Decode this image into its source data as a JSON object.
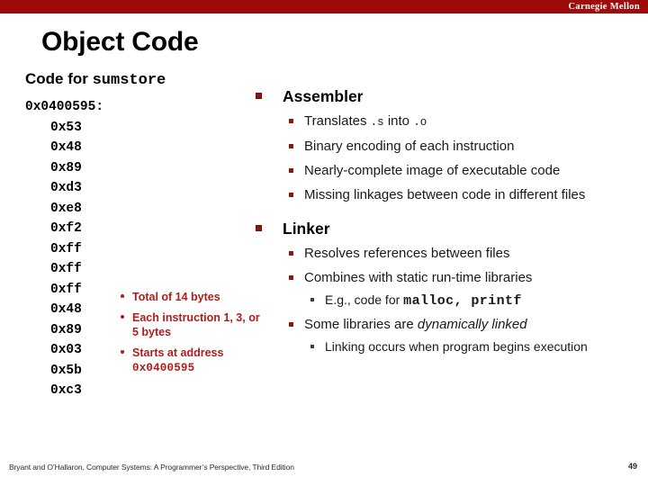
{
  "header": {
    "brand": "Carnegie Mellon",
    "bar_color": "#9E0B0B"
  },
  "title": "Object Code",
  "left": {
    "heading_prefix": "Code for ",
    "heading_mono": "sumstore",
    "address_line": "0x0400595:",
    "bytes": [
      "0x53",
      "0x48",
      "0x89",
      "0xd3",
      "0xe8",
      "0xf2",
      "0xff",
      "0xff",
      "0xff",
      "0x48",
      "0x89",
      "0x03",
      "0x5b",
      "0xc3"
    ],
    "notes": [
      {
        "text": "Total of 14 bytes",
        "mono": ""
      },
      {
        "text": "Each instruction 1, 3, or 5 bytes",
        "mono": ""
      },
      {
        "text": "Starts at address ",
        "mono": "0x0400595"
      }
    ],
    "notes_color": "#B01B1B"
  },
  "right": {
    "sections": [
      {
        "heading": "Assembler",
        "items": [
          {
            "pre": "Translates ",
            "mono1": ".s",
            "mid": " into ",
            "mono2": ".o",
            "post": ""
          },
          {
            "pre": "Binary encoding of each instruction"
          },
          {
            "pre": "Nearly-complete image of executable code"
          },
          {
            "pre": "Missing linkages between code in different files"
          }
        ]
      },
      {
        "heading": "Linker",
        "items": [
          {
            "pre": "Resolves references between files"
          },
          {
            "pre": "Combines with static run-time libraries"
          },
          {
            "sub": true,
            "pre": "E.g., code for ",
            "monob": "malloc, printf"
          },
          {
            "pre": "Some libraries are ",
            "ital": "dynamically linked"
          },
          {
            "sub": true,
            "pre": "Linking occurs when program begins execution"
          }
        ]
      }
    ],
    "bullet_color": "#8C1515"
  },
  "footer": {
    "citation": "Bryant and O’Hallaron, Computer Systems: A Programmer’s Perspective, Third Edition",
    "page": "49"
  }
}
